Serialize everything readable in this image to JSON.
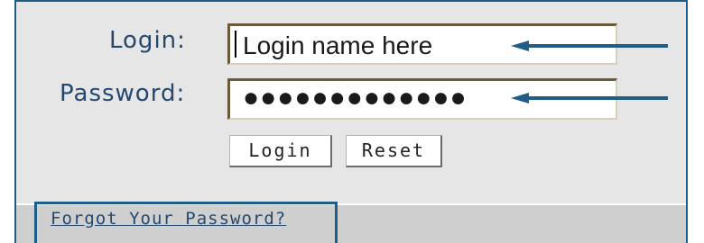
{
  "form": {
    "login_label": "Login:",
    "password_label": "Password:",
    "login_value": "Login name here",
    "password_value": "●●●●●●●●●●●●●",
    "login_button": "Login",
    "reset_button": "Reset",
    "forgot_link": "Forgot Your Password?"
  },
  "colors": {
    "frame": "#1d5d86",
    "label": "#24486e",
    "upper_panel": "#e6e6e6",
    "lower_panel": "#cfcfcf",
    "arrow": "#1d5d86"
  }
}
